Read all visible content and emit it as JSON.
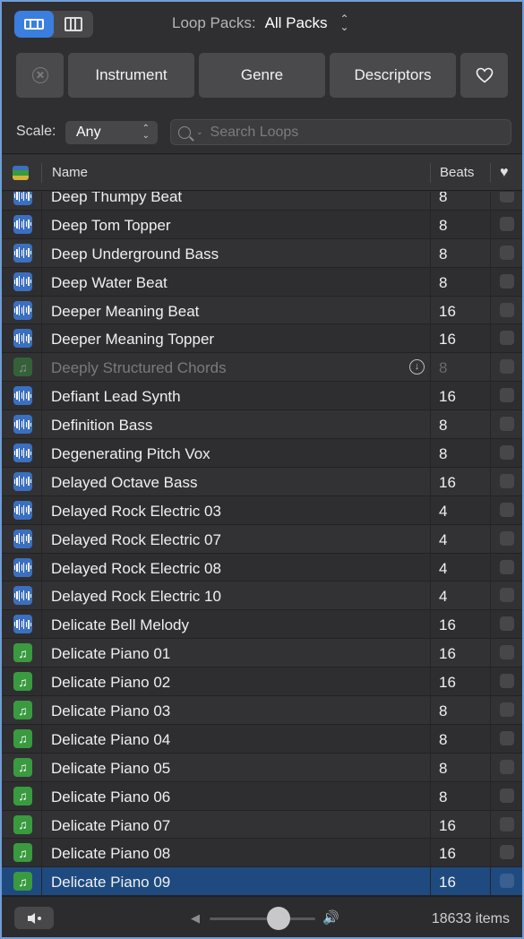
{
  "header": {
    "packs_label": "Loop Packs:",
    "packs_value": "All Packs"
  },
  "filters": {
    "instrument": "Instrument",
    "genre": "Genre",
    "descriptors": "Descriptors"
  },
  "scale": {
    "label": "Scale:",
    "value": "Any"
  },
  "search": {
    "placeholder": "Search Loops"
  },
  "columns": {
    "name": "Name",
    "beats": "Beats"
  },
  "rows": [
    {
      "name": "Deep Thumpy Beat",
      "beats": "8",
      "type": "audio"
    },
    {
      "name": "Deep Tom Topper",
      "beats": "8",
      "type": "audio"
    },
    {
      "name": "Deep Underground Bass",
      "beats": "8",
      "type": "audio"
    },
    {
      "name": "Deep Water Beat",
      "beats": "8",
      "type": "audio"
    },
    {
      "name": "Deeper Meaning Beat",
      "beats": "16",
      "type": "audio"
    },
    {
      "name": "Deeper Meaning Topper",
      "beats": "16",
      "type": "audio"
    },
    {
      "name": "Deeply Structured Chords",
      "beats": "8",
      "type": "midi",
      "not_downloaded": true
    },
    {
      "name": "Defiant Lead Synth",
      "beats": "16",
      "type": "audio"
    },
    {
      "name": "Definition Bass",
      "beats": "8",
      "type": "audio"
    },
    {
      "name": "Degenerating Pitch Vox",
      "beats": "8",
      "type": "audio"
    },
    {
      "name": "Delayed Octave Bass",
      "beats": "16",
      "type": "audio"
    },
    {
      "name": "Delayed Rock Electric 03",
      "beats": "4",
      "type": "audio"
    },
    {
      "name": "Delayed Rock Electric 07",
      "beats": "4",
      "type": "audio"
    },
    {
      "name": "Delayed Rock Electric 08",
      "beats": "4",
      "type": "audio"
    },
    {
      "name": "Delayed Rock Electric 10",
      "beats": "4",
      "type": "audio"
    },
    {
      "name": "Delicate Bell Melody",
      "beats": "16",
      "type": "audio"
    },
    {
      "name": "Delicate Piano 01",
      "beats": "16",
      "type": "midi"
    },
    {
      "name": "Delicate Piano 02",
      "beats": "16",
      "type": "midi"
    },
    {
      "name": "Delicate Piano 03",
      "beats": "8",
      "type": "midi"
    },
    {
      "name": "Delicate Piano 04",
      "beats": "8",
      "type": "midi"
    },
    {
      "name": "Delicate Piano 05",
      "beats": "8",
      "type": "midi"
    },
    {
      "name": "Delicate Piano 06",
      "beats": "8",
      "type": "midi"
    },
    {
      "name": "Delicate Piano 07",
      "beats": "16",
      "type": "midi"
    },
    {
      "name": "Delicate Piano 08",
      "beats": "16",
      "type": "midi"
    },
    {
      "name": "Delicate Piano 09",
      "beats": "16",
      "type": "midi",
      "selected": true
    }
  ],
  "footer": {
    "count": "18633 items",
    "volume": 0.65
  },
  "colors": {
    "accent": "#3a7ee0",
    "audio_icon": "#3b6fc0",
    "midi_icon": "#3a9a3f",
    "selected_row": "#1e4a80"
  }
}
